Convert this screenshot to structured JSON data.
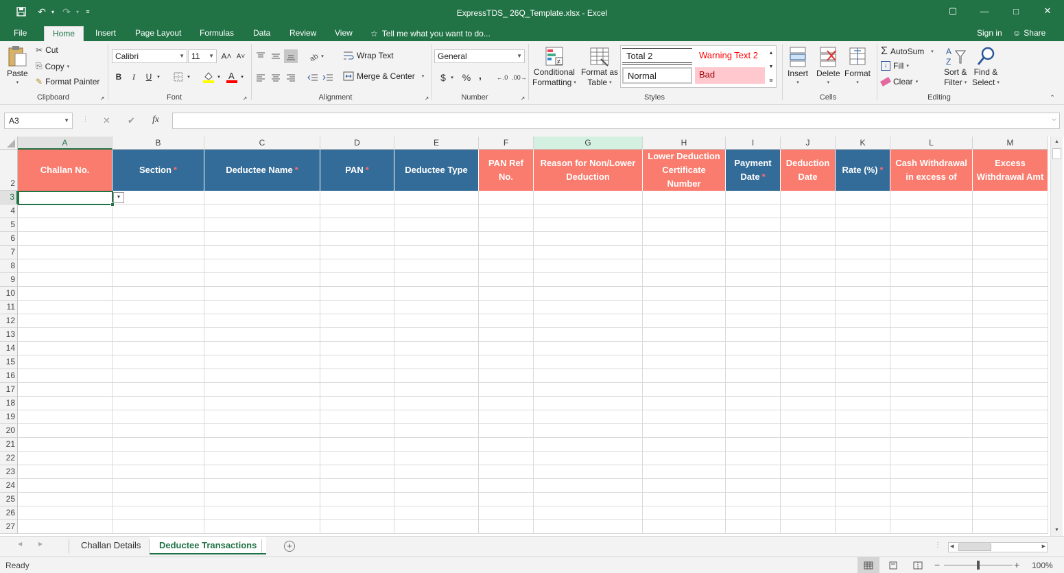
{
  "window": {
    "title": "ExpressTDS_ 26Q_Template.xlsx - Excel",
    "controls": [
      "▢",
      "—",
      "□",
      "✕"
    ]
  },
  "quick_access": {
    "save_icon": "save-icon",
    "undo_icon": "undo-icon",
    "redo_icon": "redo-icon",
    "customize_icon": "customize-icon"
  },
  "ribbon_tabs": [
    {
      "label": "File"
    },
    {
      "label": "Home"
    },
    {
      "label": "Insert"
    },
    {
      "label": "Page Layout"
    },
    {
      "label": "Formulas"
    },
    {
      "label": "Data"
    },
    {
      "label": "Review"
    },
    {
      "label": "View"
    }
  ],
  "active_tab": "Home",
  "tell_me": "Tell me what you want to do...",
  "account": {
    "sign_in": "Sign in",
    "share": "Share"
  },
  "clipboard": {
    "paste": "Paste",
    "cut": "Cut",
    "copy": "Copy",
    "format_painter": "Format Painter",
    "label": "Clipboard"
  },
  "font": {
    "name": "Calibri",
    "size": "11",
    "bold": "B",
    "italic": "I",
    "underline": "U",
    "grow": "A˄",
    "shrink": "A˅",
    "label": "Font"
  },
  "alignment": {
    "wrap_text": "Wrap Text",
    "merge_center": "Merge & Center",
    "label": "Alignment"
  },
  "number": {
    "format": "General",
    "currency": "$",
    "percent": "%",
    "comma": ",",
    "inc_dec": "←.0",
    "dec_dec": ".00→",
    "label": "Number"
  },
  "styles": {
    "conditional_formatting": [
      "Conditional",
      "Formatting"
    ],
    "format_as_table": [
      "Format as",
      "Table"
    ],
    "cells": [
      {
        "label": "Total 2"
      },
      {
        "label": "Warning Text 2"
      },
      {
        "label": "Normal"
      },
      {
        "label": "Bad"
      }
    ],
    "label": "Styles"
  },
  "cells_group": {
    "insert": "Insert",
    "delete": "Delete",
    "format": "Format",
    "label": "Cells"
  },
  "editing": {
    "autosum": "AutoSum",
    "fill": "Fill",
    "clear": "Clear",
    "sort_filter": [
      "Sort &",
      "Filter"
    ],
    "find_select": [
      "Find &",
      "Select"
    ],
    "label": "Editing"
  },
  "formula_bar": {
    "name_box": "A3",
    "cancel": "✕",
    "enter": "✔",
    "fx": "fx",
    "value": ""
  },
  "columns": [
    "A",
    "B",
    "C",
    "D",
    "E",
    "F",
    "G",
    "H",
    "I",
    "J",
    "K",
    "L",
    "M"
  ],
  "header_row_number": "2",
  "headers": [
    {
      "text": "Challan No.",
      "required": false
    },
    {
      "text": "Section",
      "required": true
    },
    {
      "text": "Deductee Name",
      "required": true
    },
    {
      "text": "PAN",
      "required": true
    },
    {
      "text": "Deductee Type",
      "required": false
    },
    {
      "text": "PAN Ref No.",
      "required": false
    },
    {
      "text": "Reason for Non/Lower Deduction",
      "required": false
    },
    {
      "text": "Lower Deduction Certificate Number",
      "required": false
    },
    {
      "text": "Payment Date",
      "required": true
    },
    {
      "text": "Deduction Date",
      "required": false
    },
    {
      "text": "Rate (%)",
      "required": true
    },
    {
      "text": "Cash Withdrawal in excess of",
      "required": false
    },
    {
      "text": "Excess Withdrawal Amt",
      "required": false
    }
  ],
  "required_mark": "*",
  "rows": [
    "3",
    "4",
    "5",
    "6",
    "7",
    "8",
    "9",
    "10",
    "11",
    "12",
    "13",
    "14",
    "15",
    "16",
    "17",
    "18",
    "19",
    "20",
    "21",
    "22",
    "23",
    "24",
    "25",
    "26",
    "27"
  ],
  "sheet_tabs": [
    {
      "label": "Challan Details"
    },
    {
      "label": "Deductee Transactions"
    }
  ],
  "active_sheet": "Deductee Transactions",
  "status": {
    "ready": "Ready",
    "zoom": "100%"
  }
}
